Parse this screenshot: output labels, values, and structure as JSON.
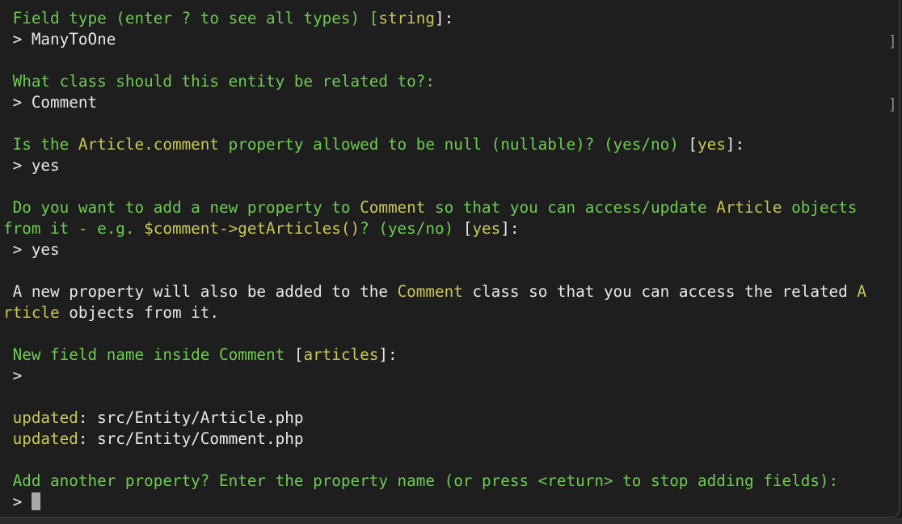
{
  "terminal": {
    "lines": [
      {
        "segments": [
          {
            "t": " Field type (enter ? to see all types) [",
            "c": "g"
          },
          {
            "t": "string",
            "c": "y"
          },
          {
            "t": "]:",
            "c": "w"
          }
        ]
      },
      {
        "segments": [
          {
            "t": " > ManyToOne",
            "c": "w"
          }
        ]
      },
      {
        "segments": []
      },
      {
        "segments": [
          {
            "t": " What class should this entity be related to?:",
            "c": "g"
          }
        ]
      },
      {
        "segments": [
          {
            "t": " > Comment",
            "c": "w"
          }
        ]
      },
      {
        "segments": []
      },
      {
        "segments": [
          {
            "t": " Is the ",
            "c": "g"
          },
          {
            "t": "Article.comment",
            "c": "y"
          },
          {
            "t": " property allowed to be null (nullable)? (yes/no) ",
            "c": "g"
          },
          {
            "t": "[",
            "c": "w"
          },
          {
            "t": "yes",
            "c": "y"
          },
          {
            "t": "]:",
            "c": "w"
          }
        ]
      },
      {
        "segments": [
          {
            "t": " > yes",
            "c": "w"
          }
        ]
      },
      {
        "segments": []
      },
      {
        "segments": [
          {
            "t": " Do you want to add a new property to ",
            "c": "g"
          },
          {
            "t": "Comment",
            "c": "y"
          },
          {
            "t": " so that you can access/update ",
            "c": "g"
          },
          {
            "t": "Article",
            "c": "y"
          },
          {
            "t": " objects",
            "c": "g"
          }
        ]
      },
      {
        "segments": [
          {
            "t": "from it - e.g. ",
            "c": "g"
          },
          {
            "t": "$comment->getArticles()",
            "c": "y"
          },
          {
            "t": "? (yes/no) ",
            "c": "g"
          },
          {
            "t": "[",
            "c": "w"
          },
          {
            "t": "yes",
            "c": "y"
          },
          {
            "t": "]:",
            "c": "w"
          }
        ]
      },
      {
        "segments": [
          {
            "t": " > yes",
            "c": "w"
          }
        ]
      },
      {
        "segments": []
      },
      {
        "segments": [
          {
            "t": " A new property will also be added to the ",
            "c": "w"
          },
          {
            "t": "Comment",
            "c": "y"
          },
          {
            "t": " class so that you can access the related ",
            "c": "w"
          },
          {
            "t": "A",
            "c": "y"
          }
        ]
      },
      {
        "segments": [
          {
            "t": "rticle",
            "c": "y"
          },
          {
            "t": " objects from it.",
            "c": "w"
          }
        ]
      },
      {
        "segments": []
      },
      {
        "segments": [
          {
            "t": " New field name inside Comment ",
            "c": "g"
          },
          {
            "t": "[",
            "c": "w"
          },
          {
            "t": "articles",
            "c": "y"
          },
          {
            "t": "]:",
            "c": "w"
          }
        ]
      },
      {
        "segments": [
          {
            "t": " >",
            "c": "w"
          }
        ]
      },
      {
        "segments": []
      },
      {
        "segments": [
          {
            "t": " updated",
            "c": "y"
          },
          {
            "t": ": src/Entity/Article.php",
            "c": "w"
          }
        ]
      },
      {
        "segments": [
          {
            "t": " updated",
            "c": "y"
          },
          {
            "t": ": src/Entity/Comment.php",
            "c": "w"
          }
        ]
      },
      {
        "segments": []
      },
      {
        "segments": [
          {
            "t": " Add another property? Enter the property name (or press <return> to stop adding fields):",
            "c": "g"
          }
        ]
      },
      {
        "segments": [
          {
            "t": " > ",
            "c": "w"
          }
        ],
        "cursor": true
      }
    ],
    "right_markers": [
      {
        "line": 1,
        "text": "]"
      },
      {
        "line": 4,
        "text": "]"
      }
    ]
  },
  "colors": {
    "background": "#1e1e1e",
    "prompt_green": "#6ecb52",
    "highlight_yellow": "#c8c85a",
    "text_white": "#e8e8e8",
    "cursor": "#a9a9a9"
  }
}
